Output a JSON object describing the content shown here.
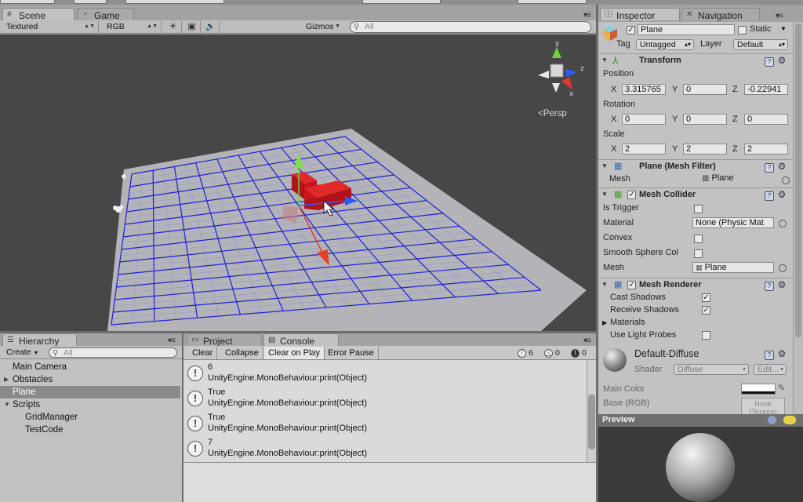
{
  "scene_panel": {
    "tabs": [
      {
        "label": "Scene"
      },
      {
        "label": "Game"
      }
    ],
    "toolbar": {
      "render_mode": "Textured",
      "color_mode": "RGB",
      "gizmos_label": "Gizmos",
      "search_placeholder": "All"
    },
    "view_label": "Persp",
    "axis_labels": {
      "x": "x",
      "y": "y",
      "z": "z"
    }
  },
  "hierarchy": {
    "tab_label": "Hierarchy",
    "create_label": "Create",
    "search_placeholder": "All",
    "items": [
      {
        "label": "Main Camera"
      },
      {
        "label": "Obstacles"
      },
      {
        "label": "Plane"
      },
      {
        "label": "Scripts"
      },
      {
        "label": "GridManager"
      },
      {
        "label": "TestCode"
      }
    ]
  },
  "console_panel": {
    "tabs": [
      {
        "label": "Project"
      },
      {
        "label": "Console"
      }
    ],
    "buttons": {
      "clear": "Clear",
      "collapse": "Collapse",
      "clear_on_play": "Clear on Play",
      "error_pause": "Error Pause"
    },
    "counts": {
      "logs": "6",
      "warnings": "0",
      "errors": "0"
    },
    "entries": [
      {
        "line1": "6",
        "line2": "UnityEngine.MonoBehaviour:print(Object)"
      },
      {
        "line1": "True",
        "line2": "UnityEngine.MonoBehaviour:print(Object)"
      },
      {
        "line1": "True",
        "line2": "UnityEngine.MonoBehaviour:print(Object)"
      },
      {
        "line1": "7",
        "line2": "UnityEngine.MonoBehaviour:print(Object)"
      }
    ]
  },
  "inspector": {
    "tabs": [
      {
        "label": "Inspector"
      },
      {
        "label": "Navigation"
      }
    ],
    "object_name": "Plane",
    "static_label": "Static",
    "tag_label": "Tag",
    "tag_value": "Untagged",
    "layer_label": "Layer",
    "layer_value": "Default",
    "transform": {
      "title": "Transform",
      "position_label": "Position",
      "rotation_label": "Rotation",
      "scale_label": "Scale",
      "axis_x": "X",
      "axis_y": "Y",
      "axis_z": "Z",
      "position": {
        "x": "3.315765",
        "y": "0",
        "z": "-0.22941"
      },
      "rotation": {
        "x": "0",
        "y": "0",
        "z": "0"
      },
      "scale": {
        "x": "2",
        "y": "2",
        "z": "2"
      }
    },
    "mesh_filter": {
      "title": "Plane (Mesh Filter)",
      "mesh_label": "Mesh",
      "mesh_value": "Plane"
    },
    "mesh_collider": {
      "title": "Mesh Collider",
      "is_trigger_label": "Is Trigger",
      "material_label": "Material",
      "material_value": "None (Physic Mat",
      "convex_label": "Convex",
      "smooth_label": "Smooth Sphere Col",
      "mesh_label": "Mesh",
      "mesh_value": "Plane"
    },
    "mesh_renderer": {
      "title": "Mesh Renderer",
      "cast_shadows_label": "Cast Shadows",
      "receive_shadows_label": "Receive Shadows",
      "materials_label": "Materials",
      "light_probes_label": "Use Light Probes"
    },
    "material": {
      "name": "Default-Diffuse",
      "shader_label": "Shader",
      "shader_value": "Diffuse",
      "edit_label": "Edit...",
      "main_color_label": "Main Color",
      "base_label": "Base (RGB)",
      "texture_none": "None",
      "texture_type": "(Texture)"
    },
    "preview_label": "Preview"
  },
  "colors": {
    "grid_blue": "#1a22d8",
    "plane_gray": "#b4b4b8",
    "selected_red": "#c8141a",
    "scene_bg": "#474747"
  }
}
